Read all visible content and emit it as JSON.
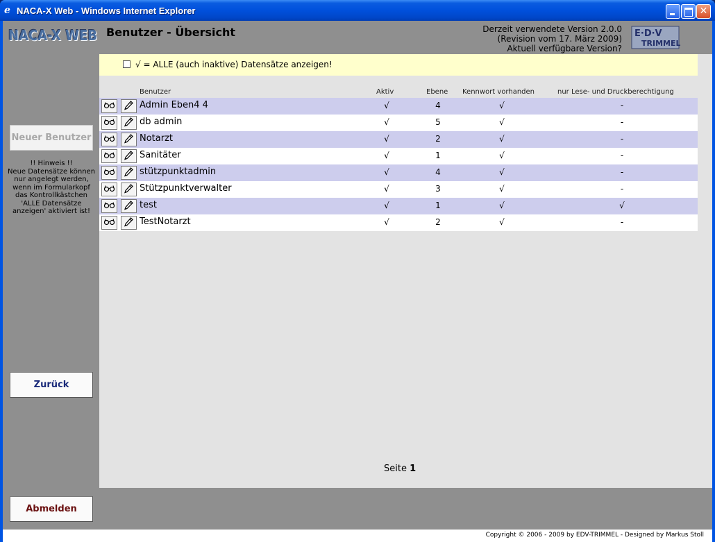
{
  "window": {
    "title": "NACA-X Web - Windows Internet Explorer",
    "app_icon": "ie-icon"
  },
  "header": {
    "logo_text": "NACA-X WEB",
    "page_title": "Benutzer - Übersicht",
    "version_line1": "Derzeit verwendete Version 2.0.0",
    "version_line2": "(Revision vom 17. März 2009)",
    "version_line3": "Aktuell verfügbare Version?",
    "brand_logo_text": "EDV TRIMMEL"
  },
  "sidebar": {
    "new_user_label": "Neuer Benutzer",
    "hint_text": "!! Hinweis !!\nNeue Datensätze können nur angelegt werden, wenn im Formularkopf das Kontrollkästchen 'ALLE Datensätze anzeigen' aktiviert ist!",
    "back_label": "Zurück",
    "logout_label": "Abmelden"
  },
  "filter": {
    "label": "√ = ALLE (auch inaktive) Datensätze anzeigen!",
    "checked": false
  },
  "table": {
    "columns": {
      "user": "Benutzer",
      "active": "Aktiv",
      "level": "Ebene",
      "password": "Kennwort vorhanden",
      "readonly": "nur Lese- und Druckberechtigung"
    },
    "rows": [
      {
        "name": "Admin Eben4 4",
        "active": "√",
        "level": "4",
        "password": "√",
        "readonly": "-"
      },
      {
        "name": "db admin",
        "active": "√",
        "level": "5",
        "password": "√",
        "readonly": "-"
      },
      {
        "name": "Notarzt",
        "active": "√",
        "level": "2",
        "password": "√",
        "readonly": "-"
      },
      {
        "name": "Sanitäter",
        "active": "√",
        "level": "1",
        "password": "√",
        "readonly": "-"
      },
      {
        "name": "stützpunktadmin",
        "active": "√",
        "level": "4",
        "password": "√",
        "readonly": "-"
      },
      {
        "name": "Stützpunktverwalter",
        "active": "√",
        "level": "3",
        "password": "√",
        "readonly": "-"
      },
      {
        "name": "test",
        "active": "√",
        "level": "1",
        "password": "√",
        "readonly": "√"
      },
      {
        "name": "TestNotarzt",
        "active": "√",
        "level": "2",
        "password": "√",
        "readonly": "-"
      }
    ]
  },
  "pager": {
    "label": "Seite",
    "page": "1"
  },
  "footer": {
    "copyright": "Copyright © 2006 - 2009 by EDV-TRIMMEL - Designed by Markus Stoll"
  },
  "colors": {
    "titlebar": "#0054e3",
    "background": "#8f8f8f",
    "content": "#e3e3e3",
    "filter_bar": "#ffffcc",
    "row_alt": "#cdcded"
  }
}
